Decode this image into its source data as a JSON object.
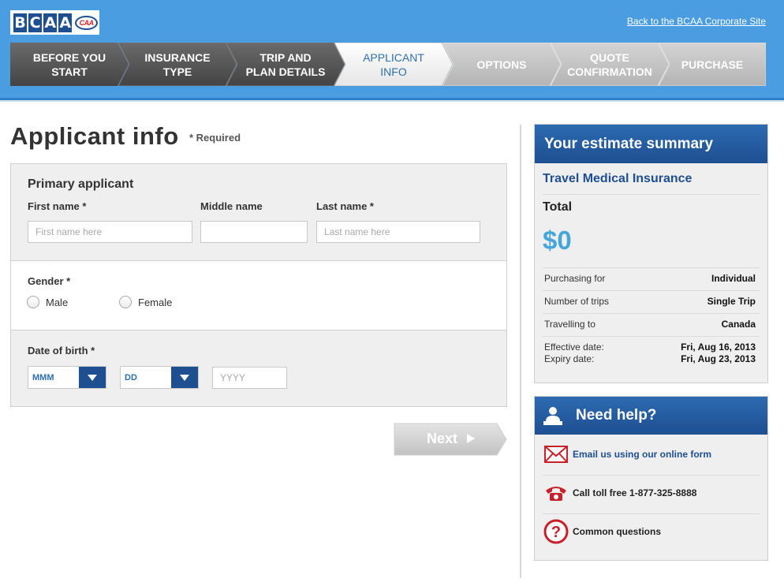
{
  "header": {
    "logo_letters": [
      "B",
      "C",
      "A",
      "A"
    ],
    "logo_badge": "CAA",
    "corporate_link": "Back to the BCAA Corporate Site"
  },
  "steps": [
    {
      "label_line1": "BEFORE YOU",
      "label_line2": "START",
      "state": "done"
    },
    {
      "label_line1": "INSURANCE",
      "label_line2": "TYPE",
      "state": "done"
    },
    {
      "label_line1": "TRIP AND",
      "label_line2": "PLAN DETAILS",
      "state": "done"
    },
    {
      "label_line1": "APPLICANT",
      "label_line2": "INFO",
      "state": "active"
    },
    {
      "label_line1": "OPTIONS",
      "label_line2": "",
      "state": "todo"
    },
    {
      "label_line1": "QUOTE",
      "label_line2": "CONFIRMATION",
      "state": "todo"
    },
    {
      "label_line1": "PURCHASE",
      "label_line2": "",
      "state": "todo"
    }
  ],
  "main": {
    "title": "Applicant info",
    "required_note": "* Required",
    "primary": {
      "title": "Primary applicant",
      "first_label": "First name *",
      "first_placeholder": "First name here",
      "first_value": "",
      "middle_label": "Middle name",
      "middle_value": "",
      "last_label": "Last name *",
      "last_placeholder": "Last name here",
      "last_value": ""
    },
    "gender": {
      "label": "Gender *",
      "options": [
        "Male",
        "Female"
      ],
      "selected": null
    },
    "dob": {
      "label": "Date of birth *",
      "month": "MMM",
      "day": "DD",
      "year_placeholder": "YYYY",
      "year_value": ""
    },
    "next_label": "Next"
  },
  "summary": {
    "title": "Your estimate summary",
    "product": "Travel Medical Insurance",
    "total_label": "Total",
    "total_value": "$0",
    "rows": [
      {
        "label": "Purchasing for",
        "value": "Individual"
      },
      {
        "label": "Number of trips",
        "value": "Single Trip"
      },
      {
        "label": "Travelling to",
        "value": "Canada"
      },
      {
        "label": "Effective date:",
        "value": "Fri, Aug 16, 2013"
      },
      {
        "label": "Expiry date:",
        "value": "Fri, Aug 23, 2013"
      }
    ]
  },
  "help": {
    "title": "Need help?",
    "items": [
      {
        "icon": "envelope-icon",
        "text": "Email us using our online form",
        "link": true
      },
      {
        "icon": "phone-icon",
        "text": "Call toll free 1-877-325-8888",
        "link": false
      },
      {
        "icon": "question-icon",
        "text": "Common questions",
        "link": false
      }
    ]
  },
  "colors": {
    "header_blue": "#4a9de0",
    "brand_navy": "#1d4f91",
    "total_blue": "#45a6db",
    "step_done": "#555555",
    "step_todo": "#c4c4c4"
  }
}
